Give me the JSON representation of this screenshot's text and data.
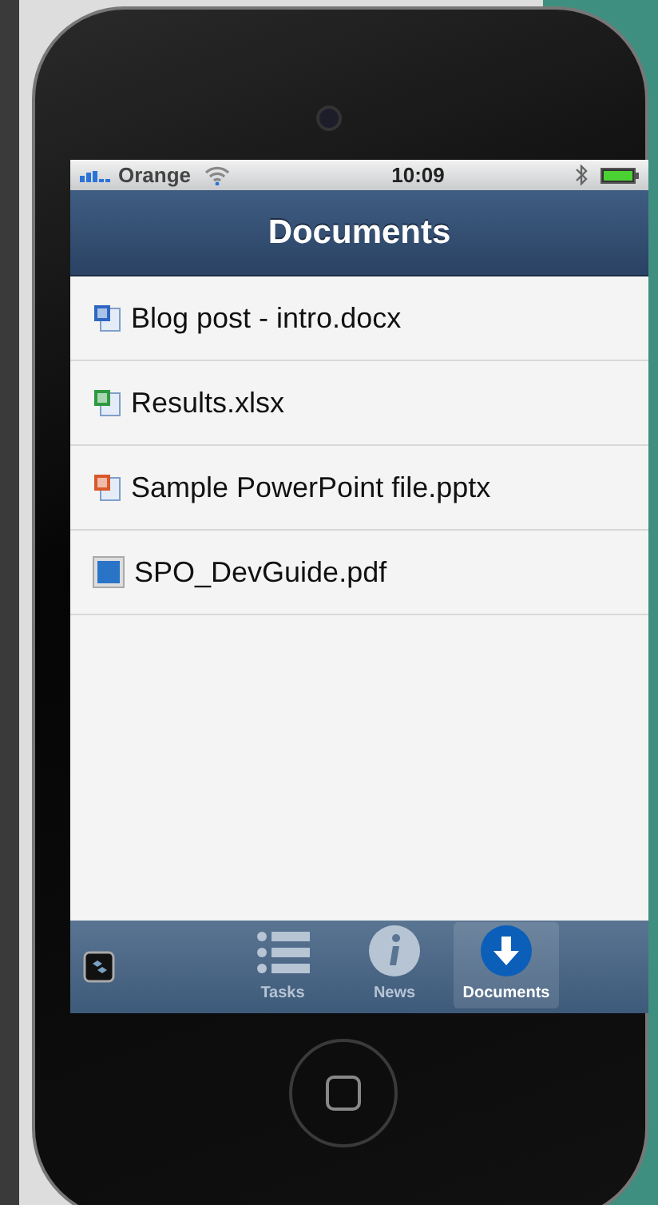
{
  "status_bar": {
    "carrier": "Orange",
    "time": "10:09"
  },
  "nav_bar": {
    "title": "Documents"
  },
  "documents": [
    {
      "name": "Blog post - intro.docx",
      "kind": "word"
    },
    {
      "name": "Results.xlsx",
      "kind": "excel"
    },
    {
      "name": "Sample PowerPoint file.pptx",
      "kind": "powerpoint"
    },
    {
      "name": "SPO_DevGuide.pdf",
      "kind": "pdf"
    }
  ],
  "tab_bar": [
    {
      "label": "Tasks",
      "kind": "list",
      "selected": false
    },
    {
      "label": "News",
      "kind": "info",
      "selected": false
    },
    {
      "label": "Documents",
      "kind": "download",
      "selected": true
    }
  ]
}
